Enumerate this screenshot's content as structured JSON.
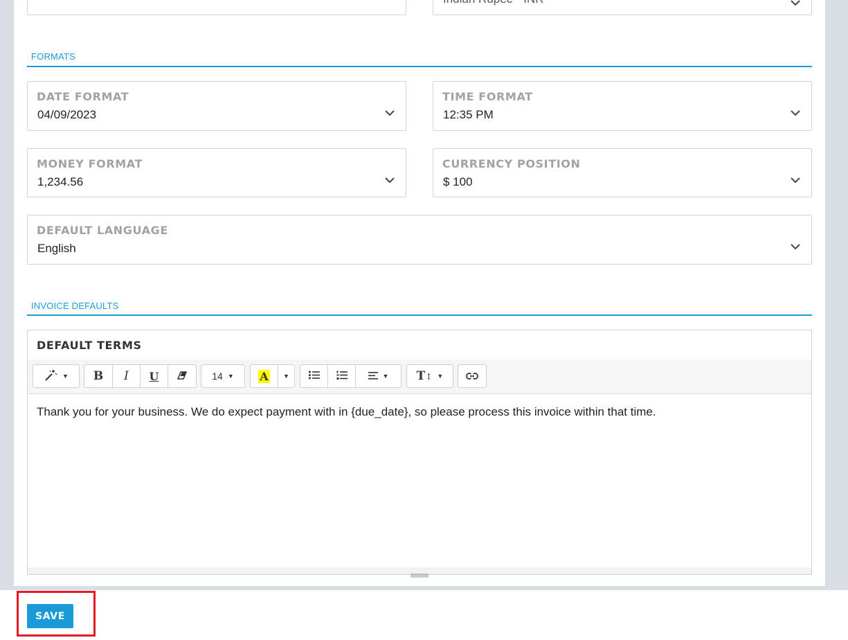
{
  "top_fields": {
    "right_partial_value": "Indian Rupee - INR"
  },
  "formats": {
    "section_title": "FORMATS",
    "date_format": {
      "label": "DATE FORMAT",
      "value": "04/09/2023"
    },
    "time_format": {
      "label": "TIME FORMAT",
      "value": "12:35 PM"
    },
    "money_format": {
      "label": "MONEY FORMAT",
      "value": "1,234.56"
    },
    "currency_position": {
      "label": "CURRENCY POSITION",
      "value": "$ 100"
    },
    "default_language": {
      "label": "DEFAULT LANGUAGE",
      "value": "English"
    }
  },
  "invoice_defaults": {
    "section_title": "INVOICE DEFAULTS",
    "default_terms_label": "DEFAULT TERMS",
    "toolbar": {
      "font_size": "14",
      "bold": "B",
      "italic": "I",
      "underline": "U",
      "highlight_letter": "A",
      "text_height": "T"
    },
    "default_terms_text": "Thank you for your business. We do expect payment with in {due_date}, so please process this invoice within that time."
  },
  "colors": {
    "accent": "#1a9bd7",
    "highlight_box": "#e01b24",
    "text_highlight": "#ffff00"
  },
  "actions": {
    "save_label": "SAVE"
  }
}
